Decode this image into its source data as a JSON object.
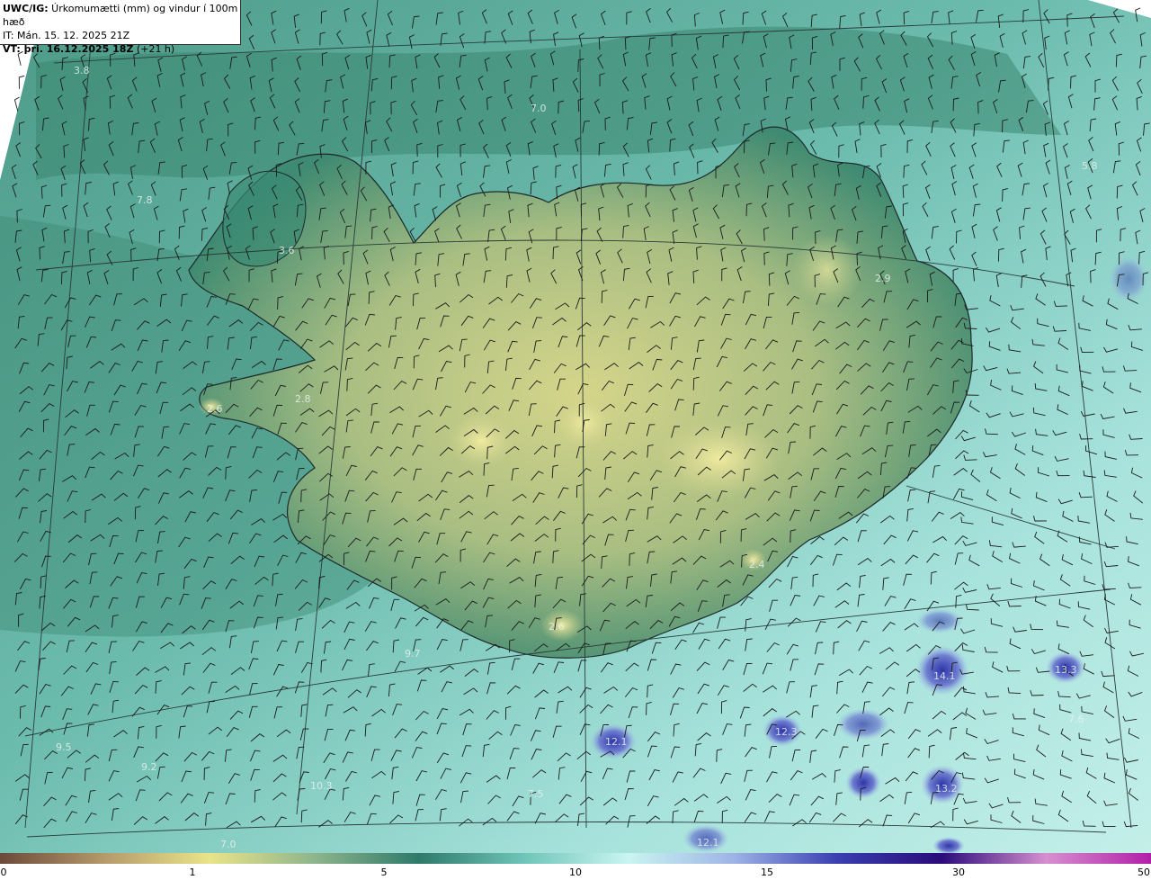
{
  "header": {
    "line1_bold": "UWC/IG:",
    "line1_text": " Úrkomumætti (mm) og vindur í 100m hæð",
    "line2": "IT: Mán. 15. 12. 2025 21Z",
    "line3_bold": "VT: þri. 16.12.2025 18Z",
    "line3_text": " (+21 h)"
  },
  "map_labels": [
    "3.8",
    "7.0",
    "7.8",
    "3.6",
    "5.8",
    "2.9",
    "2.8",
    "2.6",
    "2.4",
    "2.6",
    "9.7",
    "14.1",
    "13.3",
    "12.3",
    "12.1",
    "7.6",
    "9.5",
    "9.2",
    "10.3",
    "7.5",
    "13.2",
    "7.0",
    "12.1"
  ],
  "colorbar": {
    "ticks": [
      "0",
      "1",
      "5",
      "10",
      "15",
      "30",
      "50"
    ],
    "colors": [
      "#6b4a3a",
      "#b59a6b",
      "#e9e48a",
      "#8fb58c",
      "#2e7a6a",
      "#6ec4b8",
      "#c9f5f1",
      "#9fb5e6",
      "#3a3fb0",
      "#2a0b7a",
      "#d690d0",
      "#b21ea8"
    ]
  }
}
